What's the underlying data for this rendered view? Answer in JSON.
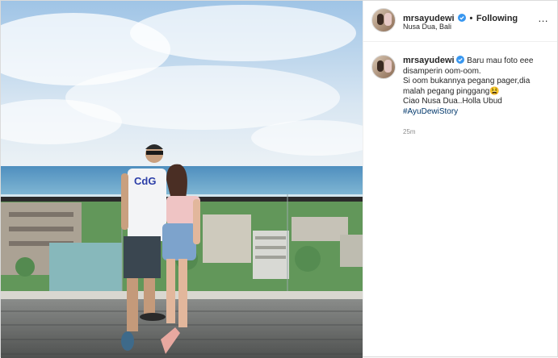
{
  "post": {
    "username": "mrsayudewi",
    "separator": "•",
    "follow_label": "Following",
    "location": "Nusa Dua, Bali",
    "more_label": "…"
  },
  "caption": {
    "username": "mrsayudewi",
    "line1": "Baru mau foto eee",
    "line2": "disamperin oom-oom.",
    "line3": "Si oom bukannya pegang pager,dia",
    "line4": "malah pegang pinggang",
    "emoji": "😫",
    "line5": "Ciao Nusa Dua..Holla Ubud",
    "hashtag": "#AyuDewiStory"
  },
  "timestamp": "25m",
  "photo": {
    "shirt_text": "CdG"
  },
  "colors": {
    "verified": "#3897f0",
    "hashtag": "#00376b",
    "sky": "#bcd9f2",
    "sea": "#6fa9cf",
    "deck": "#6d6f6f"
  }
}
